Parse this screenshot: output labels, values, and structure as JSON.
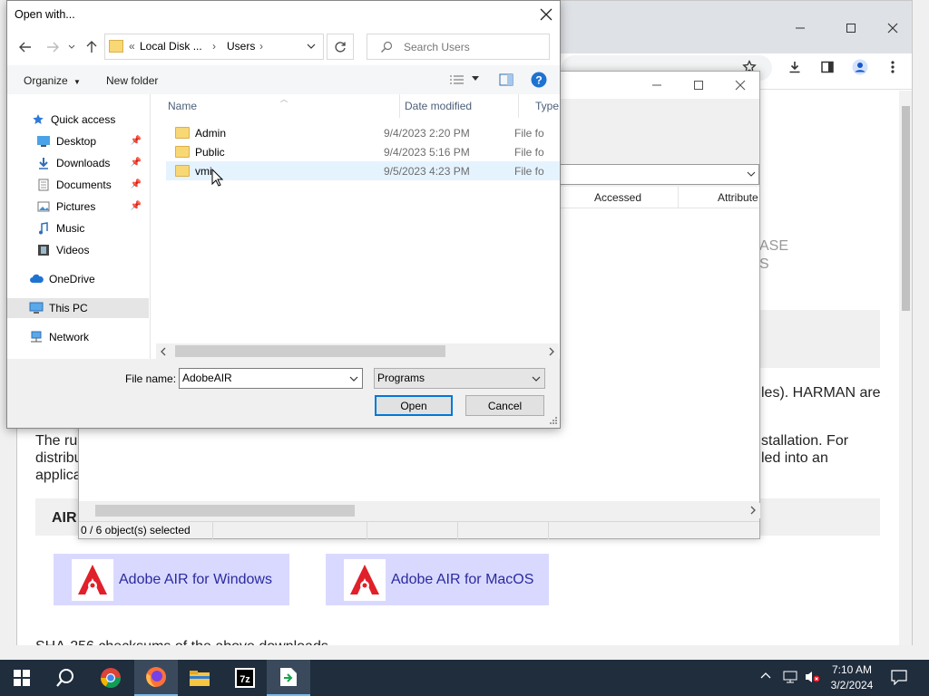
{
  "dialog": {
    "title": "Open with...",
    "address": {
      "prefix": "«",
      "crumbs": [
        "Local Disk ...",
        "Users"
      ]
    },
    "search_placeholder": "Search Users",
    "commands": {
      "organize": "Organize",
      "new_folder": "New folder"
    },
    "nav": [
      {
        "label": "Quick access",
        "icon": "star-icon",
        "pinned": false
      },
      {
        "label": "Desktop",
        "icon": "desktop-icon",
        "pinned": true
      },
      {
        "label": "Downloads",
        "icon": "download-icon",
        "pinned": true
      },
      {
        "label": "Documents",
        "icon": "document-icon",
        "pinned": true
      },
      {
        "label": "Pictures",
        "icon": "pictures-icon",
        "pinned": true
      },
      {
        "label": "Music",
        "icon": "music-icon",
        "pinned": false
      },
      {
        "label": "Videos",
        "icon": "videos-icon",
        "pinned": false
      },
      {
        "label": "OneDrive",
        "icon": "cloud-icon",
        "pinned": false
      },
      {
        "label": "This PC",
        "icon": "computer-icon",
        "pinned": false,
        "selected": true
      },
      {
        "label": "Network",
        "icon": "network-icon",
        "pinned": false
      }
    ],
    "columns": {
      "name": "Name",
      "date": "Date modified",
      "type": "Type"
    },
    "files": [
      {
        "name": "Admin",
        "date": "9/4/2023 2:20 PM",
        "type": "File fo"
      },
      {
        "name": "Public",
        "date": "9/4/2023 5:16 PM",
        "type": "File fo"
      },
      {
        "name": "vmi",
        "date": "9/5/2023 4:23 PM",
        "type": "File fo",
        "selected": true
      }
    ],
    "file_name_label": "File name:",
    "file_name_value": "AdobeAIR",
    "file_type_value": "Programs",
    "open_label": "Open",
    "cancel_label": "Cancel"
  },
  "sevenzip": {
    "col_accessed": "Accessed",
    "col_attributes": "Attribute",
    "status": "0 / 6 object(s) selected"
  },
  "page": {
    "partial_ase": "ASE",
    "partial_s": "S",
    "line_harman": "les). HARMAN are",
    "line1_left": "The ru",
    "line1_right": "stallation. For",
    "line2_left": "distribu",
    "line2_right": "led into an",
    "line3_left": "applica",
    "section_air": "AIR",
    "download_windows": "Adobe AIR for Windows",
    "download_mac": "Adobe AIR for MacOS",
    "bottom_partial": "SHA-256 checksums of the above downloads"
  },
  "taskbar": {
    "time": "7:10 AM",
    "date": "3/2/2024"
  },
  "colors": {
    "accent": "#0078d7",
    "taskbar": "#1f2d3d",
    "download_button": "#d9d9ff",
    "adobe_red": "#e0202a"
  }
}
